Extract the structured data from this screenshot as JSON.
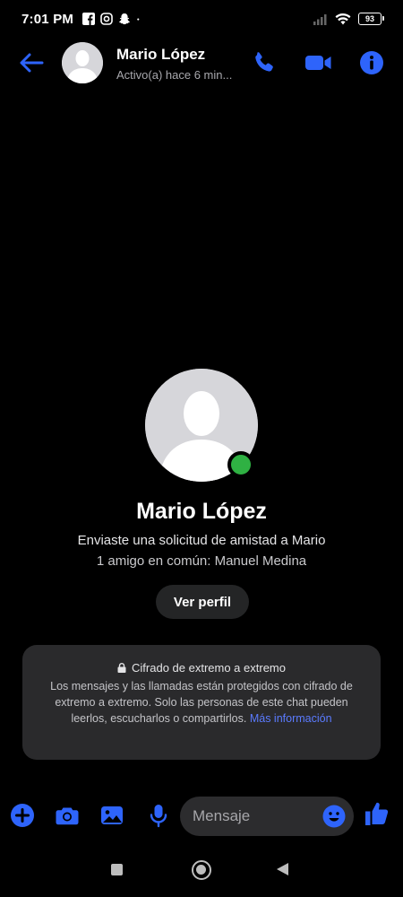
{
  "status_bar": {
    "time": "7:01 PM",
    "battery": "93",
    "icons": [
      "facebook-icon",
      "instagram-icon",
      "snapchat-icon",
      "dot-icon",
      "signal-icon",
      "wifi-icon",
      "battery-icon"
    ]
  },
  "header": {
    "contact_name": "Mario López",
    "contact_status": "Activo(a) hace 6 min...",
    "icons": [
      "back-arrow-icon",
      "phone-icon",
      "video-camera-icon",
      "info-icon"
    ]
  },
  "profile": {
    "name": "Mario López",
    "friend_request_text": "Enviaste una solicitud de amistad a Mario",
    "mutual_friends_text": "1 amigo en común: Manuel Medina",
    "view_profile_label": "Ver perfil"
  },
  "encryption_notice": {
    "title": "Cifrado de extremo a extremo",
    "body": "Los mensajes y las llamadas están protegidos con cifrado de extremo a extremo. Solo las personas de este chat pueden leerlos, escucharlos o compartirlos.",
    "link": "Más información"
  },
  "composer": {
    "placeholder": "Mensaje",
    "icons": [
      "plus-icon",
      "camera-icon",
      "gallery-icon",
      "microphone-icon",
      "emoji-icon",
      "thumbs-up-icon"
    ]
  },
  "colors": {
    "accent": "#2e64fb",
    "background": "#000000",
    "online": "#2fb143",
    "card": "#2a2a2c",
    "link": "#5b7bff"
  }
}
